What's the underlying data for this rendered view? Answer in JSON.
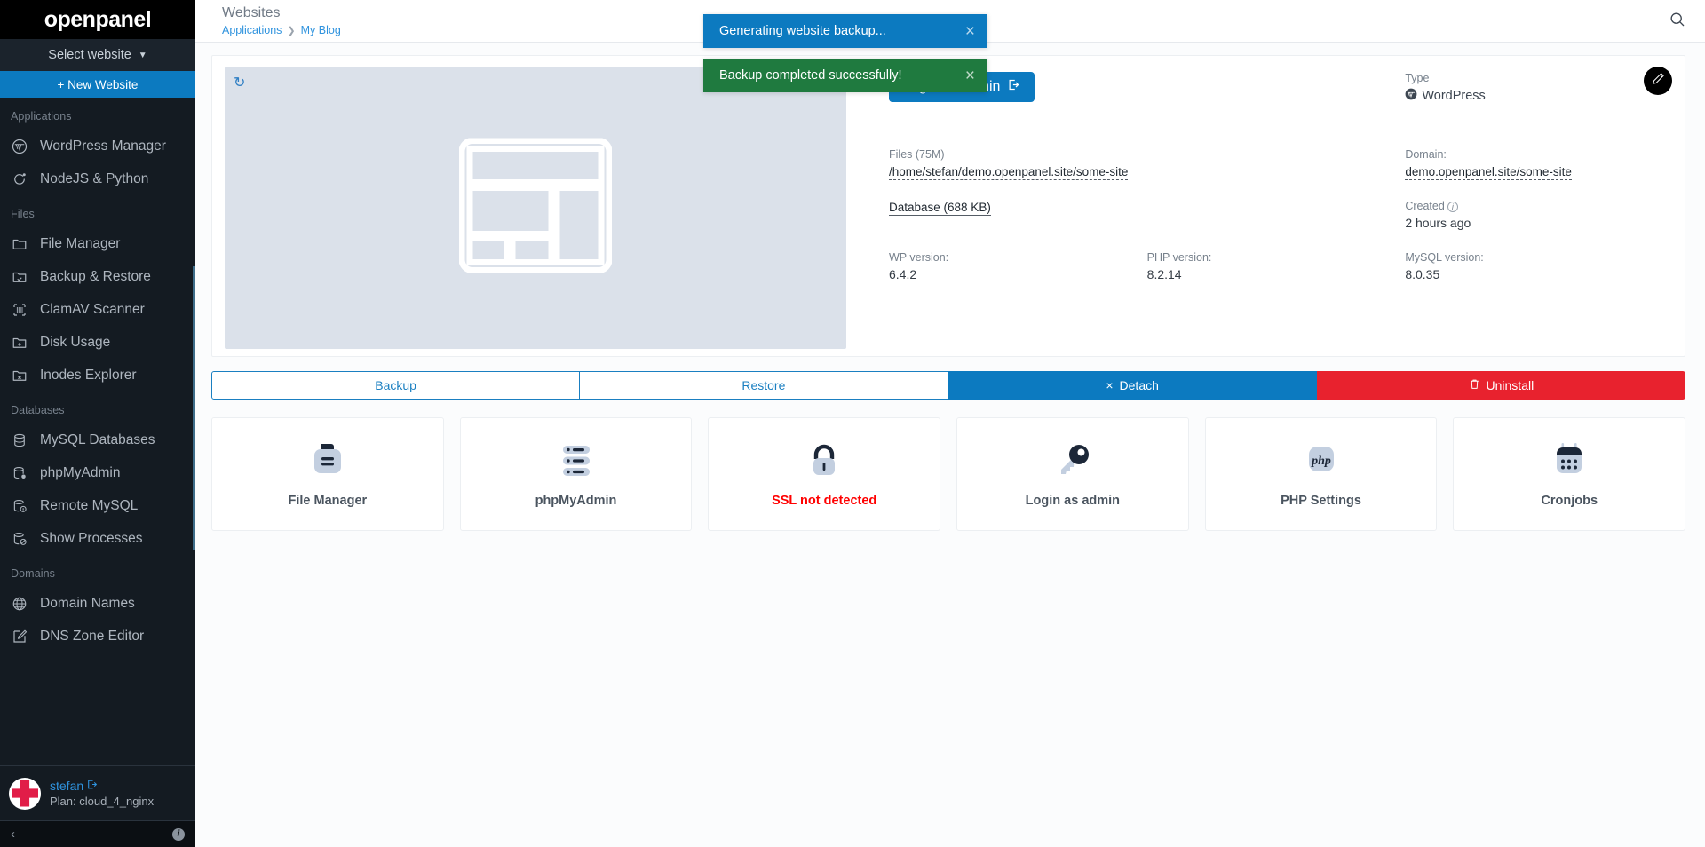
{
  "sidebar": {
    "brand": "openpanel",
    "select_website": "Select website",
    "select_chevron": "chevron-down",
    "new_website": "+ New Website",
    "groups": [
      {
        "label": "Applications",
        "items": [
          {
            "label": "WordPress Manager",
            "icon": "wordpress-icon"
          },
          {
            "label": "NodeJS & Python",
            "icon": "nodejs-python-icon"
          }
        ]
      },
      {
        "label": "Files",
        "items": [
          {
            "label": "File Manager",
            "icon": "folder-icon"
          },
          {
            "label": "Backup & Restore",
            "icon": "folder-check-icon"
          },
          {
            "label": "ClamAV Scanner",
            "icon": "scanner-icon"
          },
          {
            "label": "Disk Usage",
            "icon": "folder-plus-icon"
          },
          {
            "label": "Inodes Explorer",
            "icon": "folder-x-icon"
          }
        ]
      },
      {
        "label": "Databases",
        "items": [
          {
            "label": "MySQL Databases",
            "icon": "database-icon"
          },
          {
            "label": "phpMyAdmin",
            "icon": "database-gear-icon"
          },
          {
            "label": "Remote MySQL",
            "icon": "database-info-icon"
          },
          {
            "label": "Show Processes",
            "icon": "database-ban-icon"
          }
        ]
      },
      {
        "label": "Domains",
        "items": [
          {
            "label": "Domain Names",
            "icon": "globe-icon"
          },
          {
            "label": "DNS Zone Editor",
            "icon": "edit-square-icon"
          }
        ]
      }
    ],
    "user": {
      "name": "stefan",
      "logout_icon": "logout-icon",
      "plan": "Plan: cloud_4_nginx",
      "avatar": "user-avatar"
    },
    "footer": {
      "collapse_icon": "chevron-left-icon",
      "info_icon": "info-icon"
    }
  },
  "header": {
    "title": "Websites",
    "breadcrumb": [
      "Applications",
      "My Blog"
    ],
    "breadcrumb_separator": "❯",
    "search_icon": "search-icon"
  },
  "toasts": [
    {
      "message": "Generating website backup...",
      "type": "info",
      "color": "#0c7ac0",
      "close": "×"
    },
    {
      "message": "Backup completed successfully!",
      "type": "success",
      "color": "#1f7a3f",
      "close": "×"
    }
  ],
  "site": {
    "preview": {
      "refresh_icon": "refresh-icon",
      "placeholder_icon": "website-wireframe-placeholder",
      "background": "#dbe1ea"
    },
    "login_as_admin": "Login as Admin",
    "login_icon": "login-arrow-icon",
    "edit_icon": "pencil-icon",
    "fields": {
      "files_label": "Files (75M)",
      "files_path": "/home/stefan/demo.openpanel.site/some-site",
      "database_link": "Database (688 KB)",
      "type_label": "Type",
      "type_value": "WordPress",
      "type_icon": "wordpress-icon",
      "domain_label": "Domain:",
      "domain_value": "demo.openpanel.site/some-site",
      "created_label": "Created",
      "created_info_icon": "info-circle-icon",
      "created_value": "2 hours ago",
      "wp_version_label": "WP version:",
      "wp_version_value": "6.4.2",
      "php_version_label": "PHP version:",
      "php_version_value": "8.2.14",
      "mysql_version_label": "MySQL version:",
      "mysql_version_value": "8.0.35"
    }
  },
  "actions": [
    {
      "label": "Backup",
      "style": "outline",
      "icon": null
    },
    {
      "label": "Restore",
      "style": "outline",
      "icon": null
    },
    {
      "label": "Detach",
      "style": "blue",
      "icon": "×"
    },
    {
      "label": "Uninstall",
      "style": "red",
      "icon": "🗑"
    }
  ],
  "tiles": [
    {
      "label": "File Manager",
      "icon": "file-manager-icon",
      "danger": false
    },
    {
      "label": "phpMyAdmin",
      "icon": "phpmyadmin-server-icon",
      "danger": false
    },
    {
      "label": "SSL not detected",
      "icon": "lock-icon",
      "danger": true
    },
    {
      "label": "Login as admin",
      "icon": "key-icon",
      "danger": false
    },
    {
      "label": "PHP Settings",
      "icon": "php-icon",
      "danger": false
    },
    {
      "label": "Cronjobs",
      "icon": "calendar-icon",
      "danger": false
    }
  ],
  "colors": {
    "accent_blue": "#0c7ac0",
    "danger_red": "#e8222e",
    "success_green": "#1f7a3f",
    "sidebar_bg": "#141b22",
    "icon_fill": "#c3cfe0",
    "icon_dark": "#1c2738"
  }
}
